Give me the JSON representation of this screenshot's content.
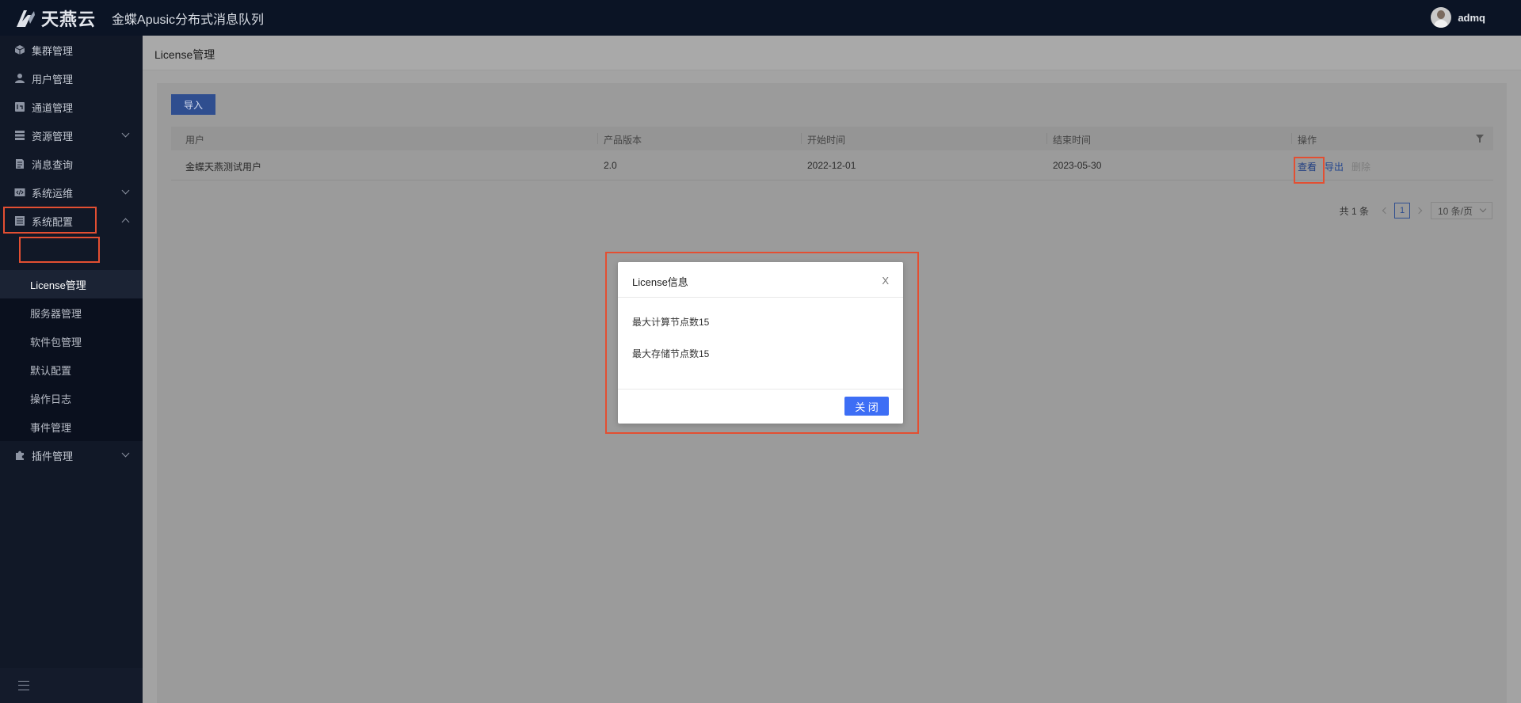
{
  "header": {
    "logo_text": "天燕云",
    "app_title": "金蝶Apusic分布式消息队列",
    "username": "admq"
  },
  "sidebar": {
    "items": [
      {
        "label": "集群管理",
        "icon": "cube-icon"
      },
      {
        "label": "用户管理",
        "icon": "user-icon"
      },
      {
        "label": "通道管理",
        "icon": "channel-icon"
      },
      {
        "label": "资源管理",
        "icon": "resource-icon"
      },
      {
        "label": "消息查询",
        "icon": "message-icon"
      },
      {
        "label": "系统运维",
        "icon": "code-icon"
      },
      {
        "label": "系统配置",
        "icon": "config-icon"
      },
      {
        "label": "插件管理",
        "icon": "puzzle-icon"
      }
    ],
    "sub_items": [
      {
        "label": "License管理"
      },
      {
        "label": "服务器管理"
      },
      {
        "label": "软件包管理"
      },
      {
        "label": "默认配置"
      },
      {
        "label": "操作日志"
      },
      {
        "label": "事件管理"
      }
    ]
  },
  "page": {
    "title": "License管理",
    "import_button": "导入"
  },
  "table": {
    "columns": [
      "用户",
      "产品版本",
      "开始时间",
      "结束时间",
      "操作"
    ],
    "rows": [
      {
        "user": "金蝶天燕测试用户",
        "version": "2.0",
        "start": "2022-12-01",
        "end": "2023-05-30"
      }
    ],
    "actions": {
      "view": "查看",
      "export": "导出",
      "delete": "删除"
    }
  },
  "pagination": {
    "total": "共 1 条",
    "current_page": "1",
    "page_size": "10 条/页"
  },
  "modal": {
    "title": "License信息",
    "close_x": "X",
    "lines": [
      "最大计算节点数15",
      "最大存储节点数15"
    ],
    "close_button": "关 闭"
  },
  "colors": {
    "highlight": "#e34f32",
    "primary": "#3d6ef5",
    "sidebar_bg": "#111827"
  }
}
